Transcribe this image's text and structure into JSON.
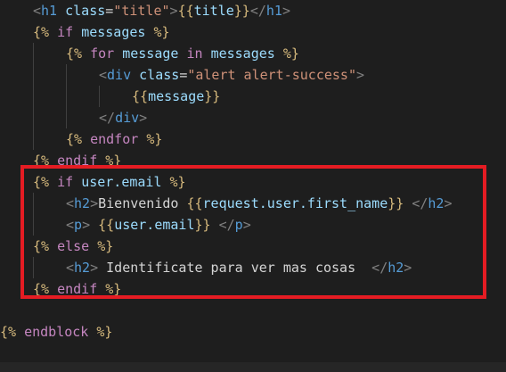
{
  "editor": {
    "theme_colors": {
      "background": "#1e1e1e",
      "template_brace": "#d7ba7d",
      "keyword": "#c586c0",
      "identifier": "#9cdcfe",
      "tag_bracket": "#808080",
      "tag_name": "#569cd6",
      "string": "#ce9178",
      "plain_text": "#d4d4d4",
      "highlight_border": "#e51c23"
    },
    "lines": [
      {
        "tokens": [
          {
            "t": "<",
            "c": "tagbracket"
          },
          {
            "t": "h1",
            "c": "tag"
          },
          {
            "t": " ",
            "c": "text"
          },
          {
            "t": "class",
            "c": "attr"
          },
          {
            "t": "=",
            "c": "text"
          },
          {
            "t": "\"title\"",
            "c": "string"
          },
          {
            "t": ">",
            "c": "tagbracket"
          },
          {
            "t": "{{",
            "c": "brace"
          },
          {
            "t": "title",
            "c": "ident"
          },
          {
            "t": "}}",
            "c": "brace"
          },
          {
            "t": "</",
            "c": "tagbracket"
          },
          {
            "t": "h1",
            "c": "tag"
          },
          {
            "t": ">",
            "c": "tagbracket"
          }
        ]
      },
      {
        "tokens": [
          {
            "t": "{%",
            "c": "brace"
          },
          {
            "t": " if ",
            "c": "keyword"
          },
          {
            "t": "messages",
            "c": "ident"
          },
          {
            "t": " %}",
            "c": "brace"
          }
        ]
      },
      {
        "tokens": [
          {
            "t": "{%",
            "c": "brace"
          },
          {
            "t": " for ",
            "c": "keyword"
          },
          {
            "t": "message",
            "c": "ident"
          },
          {
            "t": " in ",
            "c": "keyword"
          },
          {
            "t": "messages",
            "c": "ident"
          },
          {
            "t": " %}",
            "c": "brace"
          }
        ]
      },
      {
        "tokens": [
          {
            "t": "<",
            "c": "tagbracket"
          },
          {
            "t": "div",
            "c": "tag"
          },
          {
            "t": " ",
            "c": "text"
          },
          {
            "t": "class",
            "c": "attr"
          },
          {
            "t": "=",
            "c": "text"
          },
          {
            "t": "\"alert alert-success\"",
            "c": "string"
          },
          {
            "t": ">",
            "c": "tagbracket"
          }
        ]
      },
      {
        "tokens": [
          {
            "t": "{{",
            "c": "brace"
          },
          {
            "t": "message",
            "c": "ident"
          },
          {
            "t": "}}",
            "c": "brace"
          }
        ]
      },
      {
        "tokens": [
          {
            "t": "</",
            "c": "tagbracket"
          },
          {
            "t": "div",
            "c": "tag"
          },
          {
            "t": ">",
            "c": "tagbracket"
          }
        ]
      },
      {
        "tokens": [
          {
            "t": "{%",
            "c": "brace"
          },
          {
            "t": " endfor ",
            "c": "keyword"
          },
          {
            "t": "%}",
            "c": "brace"
          }
        ]
      },
      {
        "tokens": [
          {
            "t": "{%",
            "c": "brace"
          },
          {
            "t": " endif ",
            "c": "keyword"
          },
          {
            "t": "%}",
            "c": "brace"
          }
        ]
      },
      {
        "tokens": [
          {
            "t": "{%",
            "c": "brace"
          },
          {
            "t": " if ",
            "c": "keyword"
          },
          {
            "t": "user.email",
            "c": "ident"
          },
          {
            "t": " %}",
            "c": "brace"
          }
        ]
      },
      {
        "tokens": [
          {
            "t": "<",
            "c": "tagbracket"
          },
          {
            "t": "h2",
            "c": "tag"
          },
          {
            "t": ">",
            "c": "tagbracket"
          },
          {
            "t": "Bienvenido ",
            "c": "text"
          },
          {
            "t": "{{",
            "c": "brace"
          },
          {
            "t": "request.user.first_name",
            "c": "ident"
          },
          {
            "t": "}}",
            "c": "brace"
          },
          {
            "t": " ",
            "c": "text"
          },
          {
            "t": "</",
            "c": "tagbracket"
          },
          {
            "t": "h2",
            "c": "tag"
          },
          {
            "t": ">",
            "c": "tagbracket"
          }
        ]
      },
      {
        "tokens": [
          {
            "t": "<",
            "c": "tagbracket"
          },
          {
            "t": "p",
            "c": "tag"
          },
          {
            "t": ">",
            "c": "tagbracket"
          },
          {
            "t": " ",
            "c": "text"
          },
          {
            "t": "{{",
            "c": "brace"
          },
          {
            "t": "user.email",
            "c": "ident"
          },
          {
            "t": "}}",
            "c": "brace"
          },
          {
            "t": " ",
            "c": "text"
          },
          {
            "t": "</",
            "c": "tagbracket"
          },
          {
            "t": "p",
            "c": "tag"
          },
          {
            "t": ">",
            "c": "tagbracket"
          }
        ]
      },
      {
        "tokens": [
          {
            "t": "{%",
            "c": "brace"
          },
          {
            "t": " else ",
            "c": "keyword"
          },
          {
            "t": "%}",
            "c": "brace"
          }
        ]
      },
      {
        "tokens": [
          {
            "t": "<",
            "c": "tagbracket"
          },
          {
            "t": "h2",
            "c": "tag"
          },
          {
            "t": ">",
            "c": "tagbracket"
          },
          {
            "t": " Identificate para ver mas cosas  ",
            "c": "text"
          },
          {
            "t": "</",
            "c": "tagbracket"
          },
          {
            "t": "h2",
            "c": "tag"
          },
          {
            "t": ">",
            "c": "tagbracket"
          }
        ]
      },
      {
        "tokens": [
          {
            "t": "{%",
            "c": "brace"
          },
          {
            "t": " endif ",
            "c": "keyword"
          },
          {
            "t": "%}",
            "c": "brace"
          }
        ]
      },
      {
        "tokens": []
      },
      {
        "tokens": [
          {
            "t": "{%",
            "c": "brace"
          },
          {
            "t": " endblock ",
            "c": "keyword"
          },
          {
            "t": "%}",
            "c": "brace"
          }
        ]
      }
    ]
  }
}
